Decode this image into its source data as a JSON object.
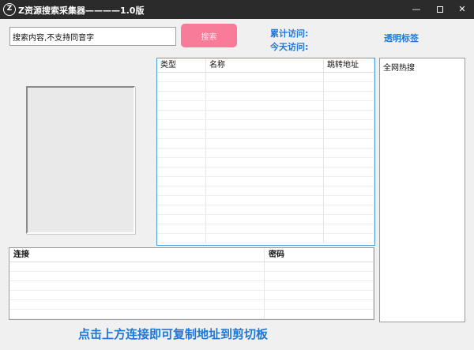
{
  "window": {
    "logo_letter": "Z",
    "title": "Z资源搜索采集器————1.0版",
    "controls": {
      "minimize": "—",
      "close": "✕"
    }
  },
  "search": {
    "value": "搜索内容,不支持同音字",
    "button_label": "搜索"
  },
  "stats": {
    "total_visits_label": "累计访问:",
    "today_visits_label": "今天访问:"
  },
  "transparent_tag_label": "透明标签",
  "results_table": {
    "columns": [
      "类型",
      "名称",
      "跳转地址"
    ],
    "row_count": 18
  },
  "hot_list": {
    "title": "全网热搜"
  },
  "links_table": {
    "columns": [
      "连接",
      "密码"
    ],
    "row_count": 6
  },
  "footer": {
    "hint": "点击上方连接即可复制地址到剪切板"
  },
  "colors": {
    "accent_blue": "#1e78d8",
    "search_button": "#f87b9a",
    "titlebar": "#2b2b2b",
    "table_border": "#4a9edb"
  },
  "icons": {
    "app_logo": "z-circle-logo-icon",
    "minimize": "minimize-icon",
    "maximize": "maximize-icon",
    "close": "close-icon"
  }
}
